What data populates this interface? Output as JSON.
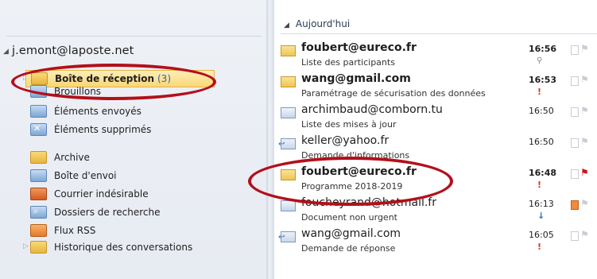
{
  "account": {
    "name": "j.emont@laposte.net"
  },
  "folders": [
    {
      "label": "Boîte de réception",
      "count": "(3)",
      "icon": "inbox-icon"
    },
    {
      "label": "Brouillons",
      "icon": "drafts-icon"
    },
    {
      "label": "Éléments envoyés",
      "icon": "sent-items-icon"
    },
    {
      "label": "Éléments supprimés",
      "icon": "deleted-items-icon"
    },
    {
      "label": "Archive",
      "icon": "archive-folder-icon"
    },
    {
      "label": "Boîte d'envoi",
      "icon": "outbox-icon"
    },
    {
      "label": "Courrier indésirable",
      "icon": "junk-mail-icon"
    },
    {
      "label": "Dossiers de recherche",
      "icon": "search-folders-icon"
    },
    {
      "label": "Flux RSS",
      "icon": "rss-icon"
    },
    {
      "label": "Historique des conversations",
      "icon": "conversation-history-icon"
    }
  ],
  "list": {
    "group_header": "Aujourd'hui",
    "messages": [
      {
        "sender": "foubert@eureco.fr",
        "subject": "Liste des participants",
        "time": "16:56",
        "unread": true,
        "marker": "attachment",
        "icon": "unread-mail-icon",
        "flagged": false
      },
      {
        "sender": "wang@gmail.com",
        "subject": "Paramétrage de sécurisation des données",
        "time": "16:53",
        "unread": true,
        "marker": "high-importance",
        "icon": "unread-mail-icon",
        "flagged": false
      },
      {
        "sender": "archimbaud@comborn.tu",
        "subject": "Liste des mises à jour",
        "time": "16:50",
        "unread": false,
        "marker": "",
        "icon": "read-mail-icon",
        "flagged": false
      },
      {
        "sender": "keller@yahoo.fr",
        "subject": "Demande d'informations",
        "time": "16:50",
        "unread": false,
        "marker": "",
        "icon": "replied-mail-icon",
        "flagged": false
      },
      {
        "sender": "foubert@eureco.fr",
        "subject": "Programme 2018-2019",
        "time": "16:48",
        "unread": true,
        "marker": "high-importance",
        "icon": "unread-mail-icon",
        "flagged": true
      },
      {
        "sender": "foucheyrand@hotmail.fr",
        "subject": "Document non urgent",
        "time": "16:13",
        "unread": false,
        "marker": "low-importance",
        "icon": "read-mail-icon",
        "flagged": false,
        "category": "orange"
      },
      {
        "sender": "wang@gmail.com",
        "subject": "Demande de réponse",
        "time": "16:05",
        "unread": false,
        "marker": "high-importance",
        "icon": "replied-mail-icon",
        "flagged": false
      }
    ]
  },
  "colors": {
    "annotation": "#b3101a",
    "selection": "#f9d774",
    "flag": "#c8161d"
  }
}
